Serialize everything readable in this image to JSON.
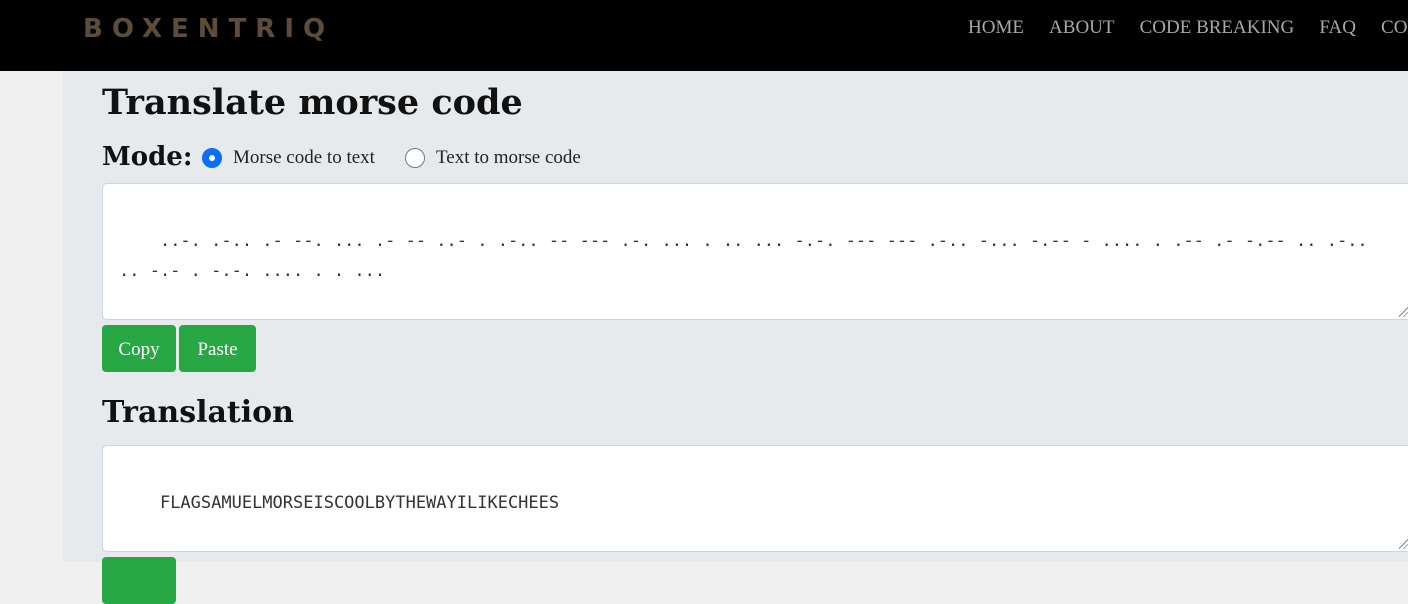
{
  "header": {
    "logo": "BOXENTRIQ",
    "nav": [
      "HOME",
      "ABOUT",
      "CODE BREAKING",
      "FAQ",
      "CONTA"
    ]
  },
  "page": {
    "title": "Translate morse code",
    "mode_label": "Mode:",
    "modes": [
      {
        "label": "Morse code to text",
        "selected": true
      },
      {
        "label": "Text to morse code",
        "selected": false
      }
    ],
    "input": "..-. .-.. .- --. ... .- -- ..- . .-.. -- --- .-. ... . .. ... -.-. --- --- .-.. -... -.-- - .... . .-- .- -.-- .. .-.. .. -.- . -.-. .... . . ...",
    "buttons": {
      "copy": "Copy",
      "paste": "Paste"
    },
    "translation_heading": "Translation",
    "translation_output": "FLAGSAMUELMORSEISCOOLBYTHEWAYILIKECHEES"
  },
  "colors": {
    "accent_green": "#28a745",
    "radio_blue": "#0d6efd",
    "header_bg": "#000000",
    "logo_color": "#5e4c3a"
  }
}
